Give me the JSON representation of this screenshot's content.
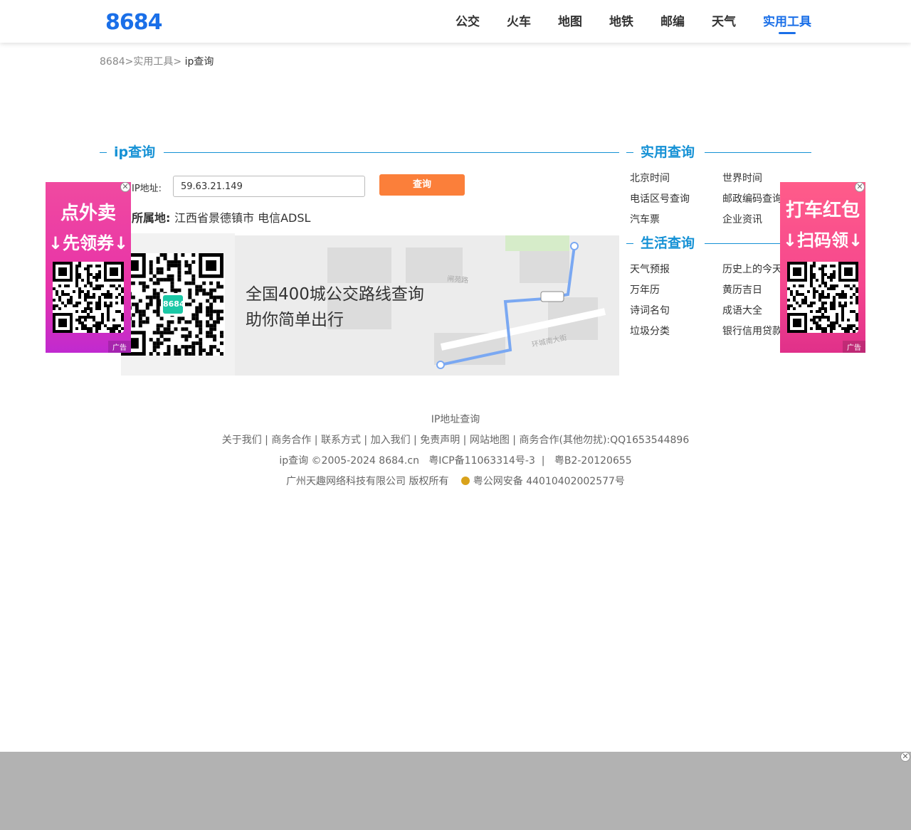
{
  "header": {
    "logo": "8684",
    "nav": [
      "公交",
      "火车",
      "地图",
      "地铁",
      "邮编",
      "天气",
      "实用工具"
    ],
    "active_index": 6
  },
  "breadcrumb": {
    "home": "8684",
    "sep1": ">",
    "tools": "实用工具",
    "sep2": ">",
    "current": "ip查询"
  },
  "main": {
    "title": "ip查询",
    "ip_label": "IP地址:",
    "ip_value": "59.63.21.149",
    "query_button": "查询",
    "location_label": "所属地:",
    "location_value": "江西省景德镇市 电信ADSL"
  },
  "banner": {
    "line1": "全国400城公交路线查询",
    "line2": "助你简单出行",
    "road_label1": "闸苑路",
    "road_label2": "环城南大街",
    "qr_center": "8684"
  },
  "sidebar": {
    "practical_title": "实用查询",
    "practical_items": [
      "北京时间",
      "世界时间",
      "电话区号查询",
      "邮政编码查询",
      "汽车票",
      "企业资讯"
    ],
    "life_title": "生活查询",
    "life_items": [
      "天气预报",
      "历史上的今天",
      "万年历",
      "黄历吉日",
      "诗词名句",
      "成语大全",
      "垃圾分类",
      "银行信用贷款"
    ]
  },
  "ads": {
    "left_line1": "点外卖",
    "left_line2": "↓先领券↓",
    "right_line1": "打车红包",
    "right_line2": "↓扫码领↓",
    "tag": "广告",
    "close": "✕"
  },
  "footer": {
    "line1": "IP地址查询",
    "links": [
      "关于我们",
      "商务合作",
      "联系方式",
      "加入我们",
      "免责声明",
      "网站地图"
    ],
    "contact": "商务合作(其他勿扰):QQ1653544896",
    "copyright": "ip查询 ©2005-2024 8684.cn",
    "icp": "粤ICP备11063314号-3",
    "b2": "粤B2-20120655",
    "company": "广州天趣网络科技有限公司 版权所有",
    "police": "粤公网安备 44010402002577号"
  },
  "colors": {
    "brand": "#1a6fe8",
    "section": "#1591d5",
    "button": "#fb7f3a"
  }
}
